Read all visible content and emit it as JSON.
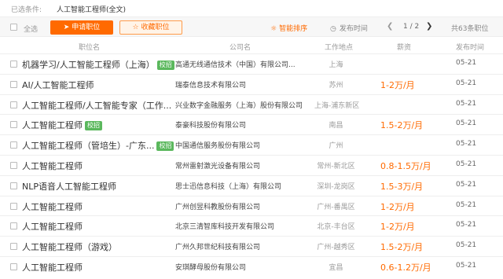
{
  "filter": {
    "label": "已选条件:",
    "chip": "人工智能工程师(全文)"
  },
  "toolbar": {
    "select_all": "全选",
    "apply": "申请职位",
    "favorite": "收藏职位",
    "sort_smart": "智能排序",
    "sort_time": "发布时间",
    "pager": "1 / 2",
    "total": "共63条职位"
  },
  "icons": {
    "apply": "send-icon",
    "favorite": "star-icon",
    "sort_smart": "bulb-icon",
    "sort_time": "clock-icon",
    "prev": "chevron-left-icon",
    "next": "chevron-right-icon"
  },
  "colors": {
    "accent": "#ff6a00",
    "badge": "#5bb85d"
  },
  "columns": {
    "job": "职位名",
    "company": "公司名",
    "location": "工作地点",
    "salary": "薪资",
    "date": "发布时间"
  },
  "rows": [
    {
      "job": "机器学习/人工智能工程师（上海）",
      "badge": "校招",
      "company": "高通无线通信技术（中国）有限公司...",
      "location": "上海",
      "salary": "",
      "date": "05-21"
    },
    {
      "job": "AI/人工智能工程师",
      "badge": "",
      "company": "瑞泰信息技术有限公司",
      "location": "苏州",
      "salary": "1-2万/月",
      "date": "05-21"
    },
    {
      "job": "人工智能工程师/人工智能专家（工作...",
      "badge": "",
      "company": "兴业数字金融服务（上海）股份有限公司",
      "location": "上海-浦东新区",
      "salary": "",
      "date": "05-21"
    },
    {
      "job": "人工智能工程师",
      "badge": "校招",
      "company": "泰豪科技股份有限公司",
      "location": "南昌",
      "salary": "1.5-2万/月",
      "date": "05-21"
    },
    {
      "job": "人工智能工程师（管培生）-广东...",
      "badge": "校招",
      "company": "中国通信服务股份有限公司",
      "location": "广州",
      "salary": "",
      "date": "05-21"
    },
    {
      "job": "人工智能工程师",
      "badge": "",
      "company": "常州雷射激光设备有限公司",
      "location": "常州-新北区",
      "salary": "0.8-1.5万/月",
      "date": "05-21"
    },
    {
      "job": "NLP语音人工智能工程师",
      "badge": "",
      "company": "思士迅信息科技（上海）有限公司",
      "location": "深圳-龙岗区",
      "salary": "1.5-3万/月",
      "date": "05-21"
    },
    {
      "job": "人工智能工程师",
      "badge": "",
      "company": "广州创昱科教股份有限公司",
      "location": "广州-番禺区",
      "salary": "1-2万/月",
      "date": "05-21"
    },
    {
      "job": "人工智能工程师",
      "badge": "",
      "company": "北京三清智库科技开发有限公司",
      "location": "北京-丰台区",
      "salary": "1-2万/月",
      "date": "05-21"
    },
    {
      "job": "人工智能工程师（游戏）",
      "badge": "",
      "company": "广州久邦世纪科技有限公司",
      "location": "广州-越秀区",
      "salary": "1.5-2万/月",
      "date": "05-21"
    },
    {
      "job": "人工智能工程师",
      "badge": "",
      "company": "安琪酵母股份有限公司",
      "location": "宜昌",
      "salary": "0.6-1.2万/月",
      "date": "05-21"
    }
  ]
}
